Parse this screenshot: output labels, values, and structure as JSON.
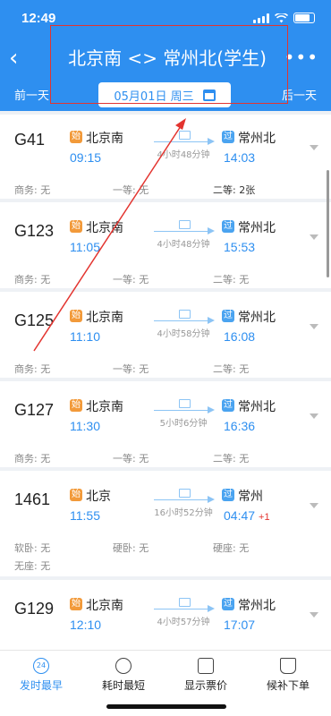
{
  "status": {
    "time": "12:49"
  },
  "header": {
    "title": "北京南 <> 常州北(学生)",
    "prev_day": "前一天",
    "next_day": "后一天",
    "date": "05月01日 周三"
  },
  "trains": [
    {
      "code": "G41",
      "from_badge": "始",
      "from": "北京南",
      "depart": "09:15",
      "duration": "4小时48分钟",
      "to_badge": "过",
      "to": "常州北",
      "arrive": "14:03",
      "arrive_plus": "",
      "seats": [
        "商务: 无",
        "一等: 无",
        "二等: 2张"
      ],
      "seats2": []
    },
    {
      "code": "G123",
      "from_badge": "始",
      "from": "北京南",
      "depart": "11:05",
      "duration": "4小时48分钟",
      "to_badge": "过",
      "to": "常州北",
      "arrive": "15:53",
      "arrive_plus": "",
      "seats": [
        "商务: 无",
        "一等: 无",
        "二等: 无"
      ],
      "seats2": []
    },
    {
      "code": "G125",
      "from_badge": "始",
      "from": "北京南",
      "depart": "11:10",
      "duration": "4小时58分钟",
      "to_badge": "过",
      "to": "常州北",
      "arrive": "16:08",
      "arrive_plus": "",
      "seats": [
        "商务: 无",
        "一等: 无",
        "二等: 无"
      ],
      "seats2": []
    },
    {
      "code": "G127",
      "from_badge": "始",
      "from": "北京南",
      "depart": "11:30",
      "duration": "5小时6分钟",
      "to_badge": "过",
      "to": "常州北",
      "arrive": "16:36",
      "arrive_plus": "",
      "seats": [
        "商务: 无",
        "一等: 无",
        "二等: 无"
      ],
      "seats2": []
    },
    {
      "code": "1461",
      "from_badge": "始",
      "from": "北京",
      "depart": "11:55",
      "duration": "16小时52分钟",
      "to_badge": "过",
      "to": "常州",
      "arrive": "04:47",
      "arrive_plus": "+1",
      "seats": [
        "软卧: 无",
        "硬卧: 无",
        "硬座: 无"
      ],
      "seats2": [
        "无座: 无"
      ]
    },
    {
      "code": "G129",
      "from_badge": "始",
      "from": "北京南",
      "depart": "12:10",
      "duration": "4小时57分钟",
      "to_badge": "过",
      "to": "常州北",
      "arrive": "17:07",
      "arrive_plus": "",
      "seats": [],
      "seats2": []
    }
  ],
  "tabs": [
    {
      "label": "发时最早",
      "icon": "24h-clock-icon",
      "icon_text": "24"
    },
    {
      "label": "耗时最短",
      "icon": "timer-icon",
      "icon_text": ""
    },
    {
      "label": "显示票价",
      "icon": "price-tag-icon",
      "icon_text": ""
    },
    {
      "label": "候补下单",
      "icon": "cart-icon",
      "icon_text": ""
    }
  ],
  "colors": {
    "primary": "#2e8ff0",
    "annotation": "#e3342f",
    "start_badge": "#f29a3a",
    "pass_badge": "#4aa3f0"
  }
}
